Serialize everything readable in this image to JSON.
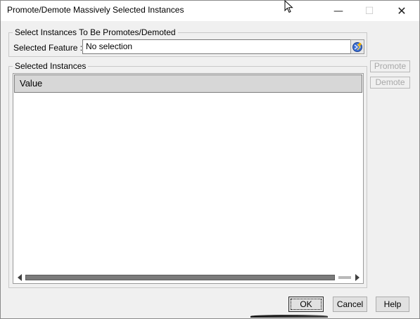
{
  "window": {
    "title": "Promote/Demote Massively Selected Instances",
    "minimize_glyph": "—",
    "maximize_glyph": "☐",
    "close_glyph": "✕"
  },
  "group_select": {
    "legend": "Select Instances To Be Promotes/Demoted",
    "feature_label": "Selected Feature :",
    "feature_value": "No selection",
    "selector_icon": "select-feature-icon"
  },
  "group_instances": {
    "legend": "Selected Instances",
    "columns": [
      "Value"
    ],
    "rows": []
  },
  "side_buttons": {
    "promote": "Promote",
    "demote": "Demote"
  },
  "footer": {
    "ok": "OK",
    "cancel": "Cancel",
    "help": "Help"
  },
  "colors": {
    "dialog_bg": "#f0f0f0",
    "header_bg": "#d7d7d7",
    "disabled_text": "#a8a8a8"
  }
}
